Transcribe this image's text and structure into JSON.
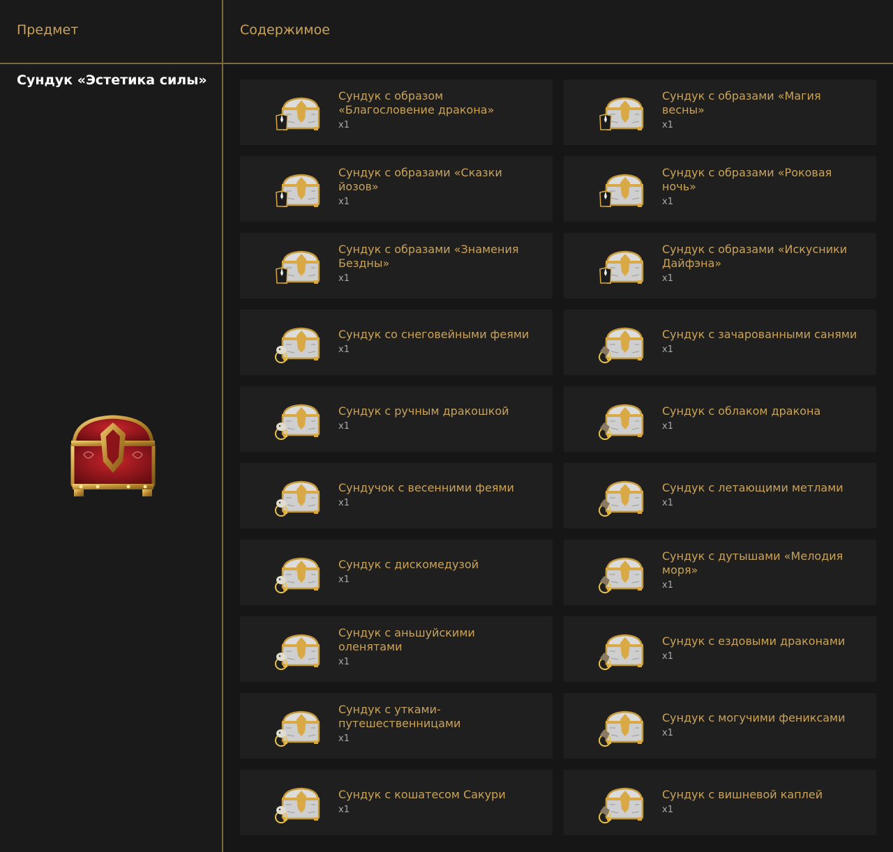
{
  "header": {
    "item_label": "Предмет",
    "content_label": "Содержимое"
  },
  "item": {
    "name": "Сундук «Эстетика силы»",
    "icon": "red-gold-chest-icon"
  },
  "contents": [
    {
      "name": "Сундук с образом «Благословение дракона»",
      "qty": "x1",
      "icon": "costume-chest-icon"
    },
    {
      "name": "Сундук с образами «Магия весны»",
      "qty": "x1",
      "icon": "costume-chest-icon"
    },
    {
      "name": "Сундук с образами «Сказки йозов»",
      "qty": "x1",
      "icon": "costume-chest-icon"
    },
    {
      "name": "Сундук с образами «Роковая ночь»",
      "qty": "x1",
      "icon": "costume-chest-icon"
    },
    {
      "name": "Сундук с образами «Знамения Бездны»",
      "qty": "x1",
      "icon": "costume-chest-icon"
    },
    {
      "name": "Сундук с образами «Искусники Дайфэна»",
      "qty": "x1",
      "icon": "costume-chest-icon"
    },
    {
      "name": "Сундук со снеговейными феями",
      "qty": "x1",
      "icon": "pet-chest-icon"
    },
    {
      "name": "Сундук с зачарованными санями",
      "qty": "x1",
      "icon": "mount-chest-icon"
    },
    {
      "name": "Сундук с ручным дракошкой",
      "qty": "x1",
      "icon": "pet-chest-icon"
    },
    {
      "name": "Сундук с облаком дракона",
      "qty": "x1",
      "icon": "mount-chest-icon"
    },
    {
      "name": "Сундучок с весенними феями",
      "qty": "x1",
      "icon": "pet-chest-icon"
    },
    {
      "name": "Сундук с летающими метлами",
      "qty": "x1",
      "icon": "mount-chest-icon"
    },
    {
      "name": "Сундук с дискомедузой",
      "qty": "x1",
      "icon": "pet-chest-icon"
    },
    {
      "name": "Сундук с дутышами «Мелодия моря»",
      "qty": "x1",
      "icon": "mount-chest-icon"
    },
    {
      "name": "Сундук с аньшуйскими оленятами",
      "qty": "x1",
      "icon": "pet-chest-icon"
    },
    {
      "name": "Сундук с ездовыми драконами",
      "qty": "x1",
      "icon": "mount-chest-icon"
    },
    {
      "name": "Сундук с утками-путешественницами",
      "qty": "x1",
      "icon": "pet-chest-icon"
    },
    {
      "name": "Сундук с могучими фениксами",
      "qty": "x1",
      "icon": "mount-chest-icon"
    },
    {
      "name": "Сундук с кошатесом Сакури",
      "qty": "x1",
      "icon": "pet-chest-icon"
    },
    {
      "name": "Сундук с вишневой каплей",
      "qty": "x1",
      "icon": "mount-chest-icon"
    }
  ]
}
